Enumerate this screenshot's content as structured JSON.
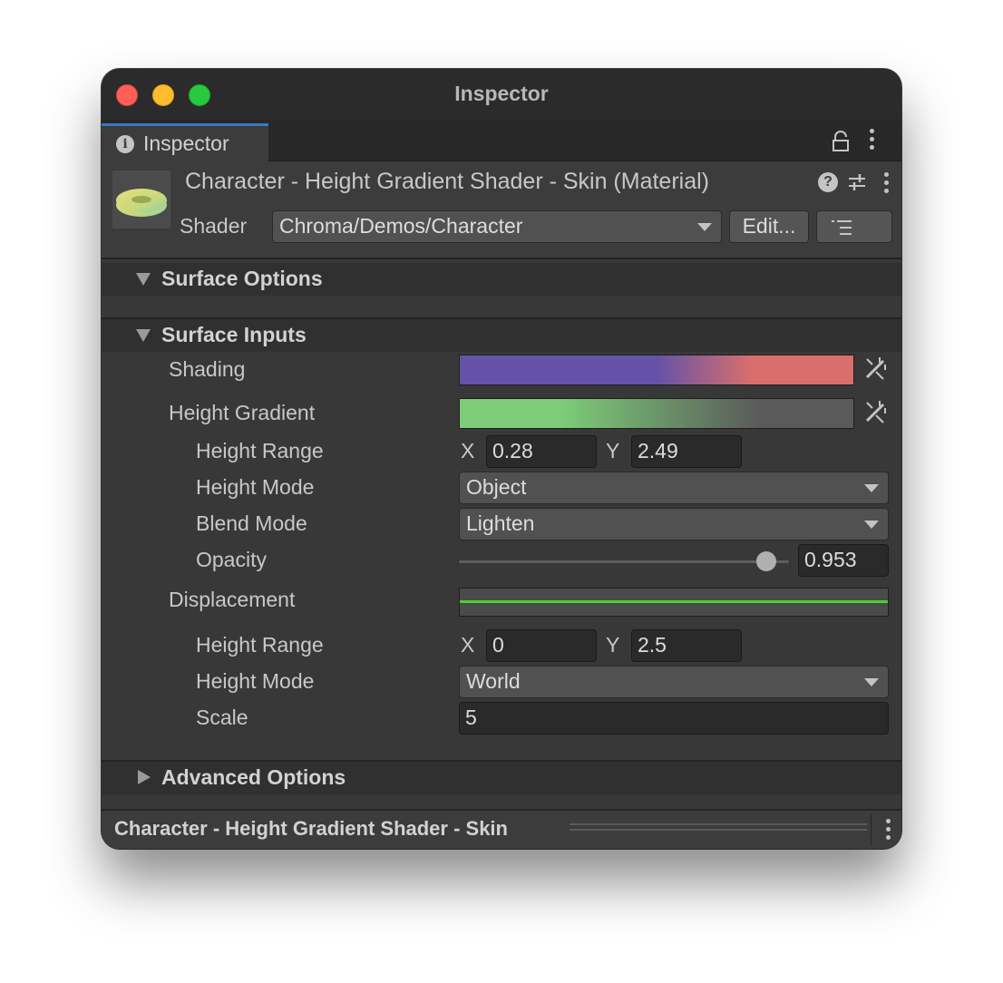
{
  "window": {
    "title": "Inspector"
  },
  "tab": {
    "label": "Inspector"
  },
  "header": {
    "material_title": "Character - Height Gradient Shader - Skin (Material)",
    "help_glyph": "?",
    "shader_label": "Shader",
    "shader_value": "Chroma/Demos/Character",
    "edit_label": "Edit..."
  },
  "sections": {
    "surface_options": {
      "title": "Surface Options",
      "expanded": true
    },
    "surface_inputs": {
      "title": "Surface Inputs",
      "expanded": true
    },
    "advanced_options": {
      "title": "Advanced Options",
      "expanded": false
    }
  },
  "shading": {
    "label": "Shading",
    "gradient_colors": [
      "#6552a8",
      "#6552a8",
      "#d86f6c",
      "#d86f6c"
    ]
  },
  "height_gradient": {
    "label": "Height Gradient",
    "gradient_colors": [
      "#7ccc78",
      "#7ccc78",
      "#5a5a5a"
    ],
    "height_range": {
      "label": "Height Range",
      "x_label": "X",
      "x": "0.28",
      "y_label": "Y",
      "y": "2.49"
    },
    "height_mode": {
      "label": "Height Mode",
      "value": "Object"
    },
    "blend_mode": {
      "label": "Blend Mode",
      "value": "Lighten"
    },
    "opacity": {
      "label": "Opacity",
      "value": "0.953",
      "slider_fraction": 0.953
    }
  },
  "displacement": {
    "label": "Displacement",
    "curve_color": "#4bd12e",
    "height_range": {
      "label": "Height Range",
      "x_label": "X",
      "x": "0",
      "y_label": "Y",
      "y": "2.5"
    },
    "height_mode": {
      "label": "Height Mode",
      "value": "World"
    },
    "scale": {
      "label": "Scale",
      "value": "5"
    }
  },
  "status": {
    "text": "Character - Height Gradient Shader - Skin"
  }
}
